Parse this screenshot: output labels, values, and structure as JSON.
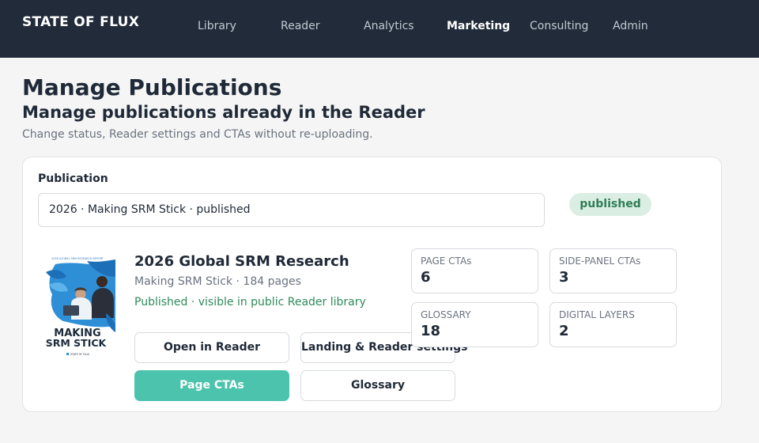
{
  "brand": "STATE OF FLUX",
  "nav": [
    {
      "label": "Library"
    },
    {
      "label": "Reader"
    },
    {
      "label": "Analytics"
    },
    {
      "label": "Marketing",
      "active": true
    },
    {
      "label": "Consulting"
    },
    {
      "label": "Admin"
    }
  ],
  "page": {
    "title": "Manage Publications",
    "subtitle": "Manage publications already in the Reader",
    "description": "Change status, Reader settings and CTAs without re-uploading."
  },
  "publication": {
    "field_label": "Publication",
    "selected": "2026 · Making SRM Stick · published",
    "status_badge": "published",
    "title": "2026 Global SRM Research",
    "meta": "Making SRM Stick · 184 pages",
    "status_line": "Published · visible in public Reader library",
    "cover": {
      "line1": "MAKING",
      "line2": "SRM STICK",
      "top_text": "2026 GLOBAL SRM RESEARCH REPORT",
      "logo_text": "STATE OF FLUX"
    }
  },
  "actions": {
    "open_reader": "Open in Reader",
    "landing_settings": "Landing & Reader settings",
    "page_ctas": "Page CTAs",
    "glossary": "Glossary"
  },
  "stats": {
    "page_ctas": {
      "label": "PAGE CTAs",
      "value": "6"
    },
    "side_panel_ctas": {
      "label": "SIDE-PANEL CTAs",
      "value": "3"
    },
    "glossary": {
      "label": "GLOSSARY",
      "value": "18"
    },
    "digital_layers": {
      "label": "DIGITAL LAYERS",
      "value": "2"
    }
  },
  "colors": {
    "topbar": "#212b39",
    "accent": "#4cc3ad",
    "published_green": "#2e8a5a",
    "badge_bg": "#dbeee3"
  }
}
